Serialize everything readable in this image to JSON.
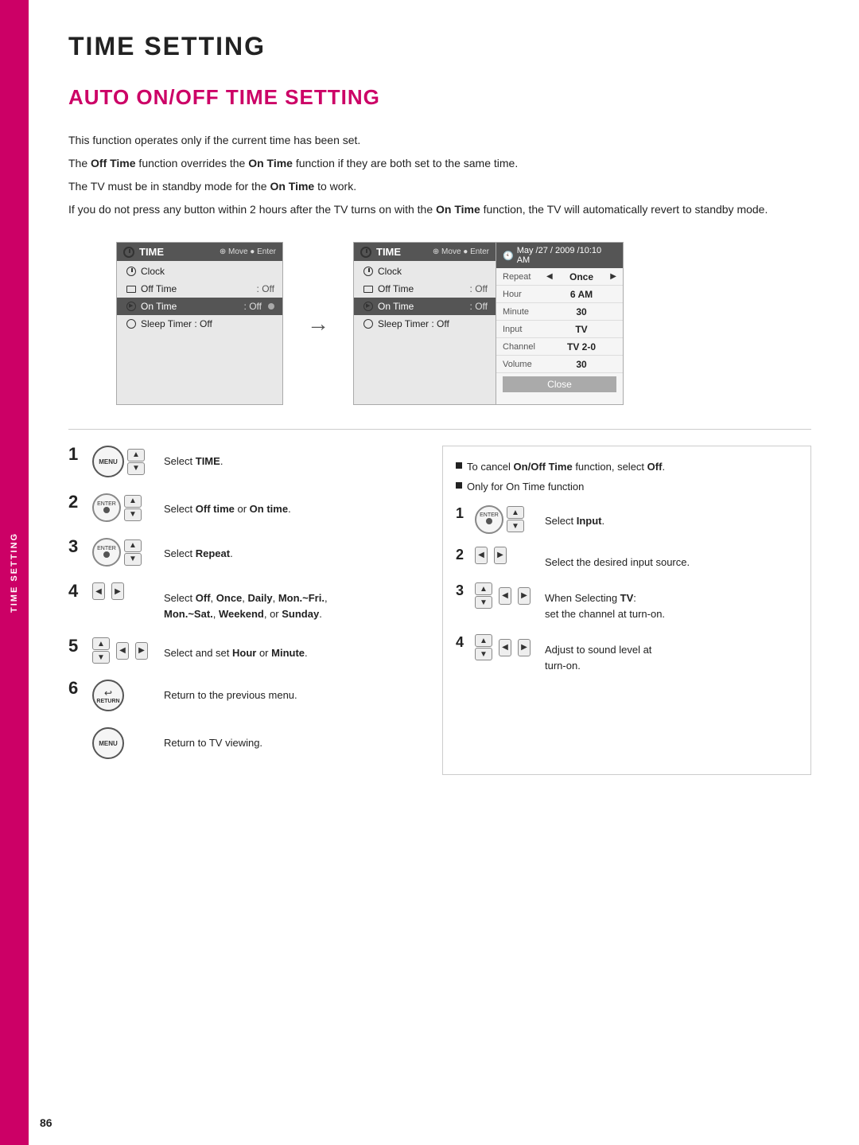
{
  "page": {
    "title": "TIME SETTING",
    "sidebar_label": "TIME SETTING",
    "section_title": "AUTO ON/OFF TIME SETTING",
    "page_number": "86"
  },
  "description": {
    "line1": "This function operates only if the current time has been set.",
    "line2_prefix": "The ",
    "line2_bold1": "Off Time",
    "line2_mid": " function overrides the ",
    "line2_bold2": "On Time",
    "line2_suffix": " function if they are both set to the same time.",
    "line3_prefix": "The TV must be in standby mode for the ",
    "line3_bold": "On Time",
    "line3_suffix": " to work.",
    "line4_prefix": "If you do not press any button within 2 hours after the TV turns on with the ",
    "line4_bold": "On Time",
    "line4_suffix": " function, the TV will automatically revert to standby mode."
  },
  "menu_left": {
    "header_title": "TIME",
    "header_nav": "Move  Enter",
    "rows": [
      {
        "label": "Clock",
        "value": "",
        "icon": "clock",
        "highlighted": false
      },
      {
        "label": "Off Time",
        "value": ": Off",
        "icon": "tv",
        "highlighted": false
      },
      {
        "label": "On Time",
        "value": ": Off",
        "icon": "ontime",
        "highlighted": true,
        "dot": true
      },
      {
        "label": "Sleep Timer",
        "value": ": Off",
        "icon": "sleep",
        "highlighted": false
      }
    ]
  },
  "menu_right": {
    "header_title": "TIME",
    "header_nav": "Move  Enter",
    "rows_left": [
      {
        "label": "Clock",
        "value": "",
        "icon": "clock",
        "highlighted": false
      },
      {
        "label": "Off Time",
        "value": ": Off",
        "icon": "tv",
        "highlighted": false
      },
      {
        "label": "On Time",
        "value": ": Off",
        "icon": "ontime",
        "highlighted": false
      },
      {
        "label": "Sleep Timer",
        "value": ": Off",
        "icon": "sleep",
        "highlighted": false
      }
    ],
    "header_right": "May /27 / 2009 /10:10 AM",
    "rows_right": [
      {
        "label": "Repeat",
        "value": "Once",
        "has_arrows": true
      },
      {
        "label": "Hour",
        "value": "6 AM",
        "has_arrows": false
      },
      {
        "label": "Minute",
        "value": "30",
        "has_arrows": false
      },
      {
        "label": "Input",
        "value": "TV",
        "has_arrows": false
      },
      {
        "label": "Channel",
        "value": "TV 2-0",
        "has_arrows": false
      },
      {
        "label": "Volume",
        "value": "30",
        "has_arrows": false
      }
    ],
    "close_button": "Close"
  },
  "steps_left": [
    {
      "number": "1",
      "icons": [
        "menu-button",
        "nav-up-down"
      ],
      "text_prefix": "Select ",
      "text_bold": "TIME",
      "text_suffix": "."
    },
    {
      "number": "2",
      "icons": [
        "enter-button",
        "nav-up-down"
      ],
      "text_prefix": "Select ",
      "text_bold1": "Off time",
      "text_mid": " or ",
      "text_bold2": "On time",
      "text_suffix": "."
    },
    {
      "number": "3",
      "icons": [
        "enter-button",
        "nav-up-down"
      ],
      "text_prefix": "Select ",
      "text_bold": "Repeat",
      "text_suffix": "."
    },
    {
      "number": "4",
      "icons": [
        "nav-left-right"
      ],
      "text_prefix": "Select ",
      "text_bold1": "Off",
      "text_mid1": ", ",
      "text_bold2": "Once",
      "text_mid2": ", ",
      "text_bold3": "Daily",
      "text_mid3": ", ",
      "text_bold4": "Mon.~Fri.",
      "text_mid4": ",\n",
      "text_bold5": "Mon.~Sat.",
      "text_mid5": ", ",
      "text_bold6": "Weekend",
      "text_mid6": ", or ",
      "text_bold7": "Sunday",
      "text_suffix": "."
    },
    {
      "number": "5",
      "icons": [
        "nav-up-down",
        "nav-left-right"
      ],
      "text_prefix": "Select and set ",
      "text_bold1": "Hour",
      "text_mid": " or ",
      "text_bold2": "Minute",
      "text_suffix": "."
    },
    {
      "number": "6",
      "icons": [
        "return-button"
      ],
      "text": "Return to the previous menu."
    },
    {
      "number": "",
      "icons": [
        "menu-button2"
      ],
      "text": "Return to TV viewing."
    }
  ],
  "steps_right": {
    "bullets": [
      "To cancel On/Off Time function, select Off.",
      "Only for On Time function"
    ],
    "steps": [
      {
        "number": "1",
        "icons": [
          "enter-button",
          "nav-up-down"
        ],
        "text_prefix": "Select ",
        "text_bold": "Input",
        "text_suffix": "."
      },
      {
        "number": "2",
        "icons": [
          "nav-left-right"
        ],
        "text": "Select the desired input source."
      },
      {
        "number": "3",
        "icons": [
          "nav-up-down",
          "nav-left-right"
        ],
        "text_prefix": "When Selecting ",
        "text_bold": "TV",
        "text_suffix": ":\nset the channel at turn-on."
      },
      {
        "number": "4",
        "icons": [
          "nav-up-down",
          "nav-left-right"
        ],
        "text": "Adjust to sound level at\nturn-on."
      }
    ]
  }
}
